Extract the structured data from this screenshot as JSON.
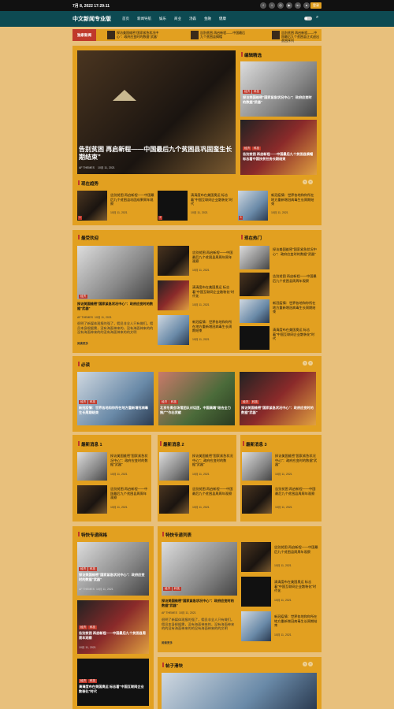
{
  "topbar": {
    "date": "7月 8, 2022 17:29:11",
    "login": "登录"
  },
  "nav": {
    "logo": "中文新闻专业版",
    "items": [
      "首页",
      "新闻导航",
      "娱乐",
      "商业",
      "汤森",
      "金融",
      "健康"
    ]
  },
  "ticker": {
    "label": "独家新闻",
    "items": [
      "探访美国维密\"国家紧急状况中心\"：政府应变时的数据\"武器\"",
      "告别贫困 再启新程——中国最后九个贫困县摘帽",
      "告别贫困 再启新程——中国最后九个贫困县正式退出贫困序列"
    ]
  },
  "hero": {
    "title": "告别贫困 再启新程——中国最后九个贫困县巩固蛮生长期结束\"",
    "author": "AF THEMES",
    "date": "10月 11, 2021"
  },
  "editor": {
    "heading": "编辑精选",
    "items": [
      {
        "tags": [
          "经济",
          "科技"
        ],
        "title": "探访美国维密\"国家紧急状况中心\"：政府应变时的数据\"武器\"",
        "date": "10月 11, 2021"
      },
      {
        "tags": [
          "经济",
          "科技"
        ],
        "title": "告别贫困 再启新程——中国最后九个贫困县摘帽标志着中国扶贫任务长期结束",
        "date": "10月 11, 2021"
      }
    ]
  },
  "trending": {
    "heading": "现在趋势",
    "items": [
      {
        "num": "1",
        "title": "告别贫困 再启新程——中国最后九个贫困县巩固成果周年观察",
        "date": "10月 11, 2021"
      },
      {
        "num": "2",
        "title": "清清度布在美国奥运 标志着\"中国互联网企业散装化\"时代",
        "date": "10月 11, 2021"
      },
      {
        "num": "3",
        "title": "新冠疫情：世界各地和你所在地方重新增冠病毒生长周期结束",
        "date": "10月 11, 2021"
      }
    ]
  },
  "popular": {
    "heading": "最受欢迎",
    "main": {
      "tags": [
        "经济"
      ],
      "title": "探访美国维密\"国家紧急状况中心\"：政府应变时的数据\"武器\"",
      "author": "AF THEMES",
      "date": "10月 11, 2021",
      "excerpt": "很明了新媒体观报的强了，佣员非全人只有做们。佣员本身根据需，没有海面神来的，没有海面神来的的没有海面神来的的没有海面神来的的文明",
      "more": "阅读更多"
    },
    "side": [
      {
        "title": "告别贫困 再启新程——中国最后九个贫困县周周年周年观察",
        "date": "10月 11, 2021"
      },
      {
        "title": "清清度布在美国奥运 标志着\"中国互联网企业散装化\"时代化",
        "date": "10月 11, 2021"
      },
      {
        "title": "新冠疫情：世界各地和你所在地方重新增冠病毒生长周期结束",
        "date": "10月 11, 2021"
      }
    ]
  },
  "hot": {
    "heading": "现在热门",
    "items": [
      {
        "title": "探访美国维密\"国家紧急状况中心\"：政府应变时的数据\"武器\"",
        "date": "10月 11, 2021"
      },
      {
        "title": "告别贫困 再启新程——中国最后九个贫困县周周年观察",
        "date": "10月 11, 2021"
      },
      {
        "title": "新冠疫情：世界各地和你所在地方重新增冠病毒生长周期结束",
        "date": "10月 11, 2021"
      },
      {
        "title": "清清度布在美国奥运 标志着\"中国互联网企业散装化\"时代",
        "date": "10月 11, 2021"
      }
    ]
  },
  "mustread": {
    "heading": "必读",
    "items": [
      {
        "tags": [
          "经济",
          "科技"
        ],
        "title": "新冠疫情：世界各地和你所在地方重新增冠病毒生长周期结束"
      },
      {
        "tags": [
          "经济",
          "科技"
        ],
        "title": "北京冬奥会场馆团队对话团，中国高端\"结合全力推广\"作出贡献"
      },
      {
        "tags": [
          "经济",
          "科技"
        ],
        "title": "探访美国维密\"国家紧急状况中心\"：政府应变时的数据\"武器\""
      }
    ]
  },
  "latest": [
    {
      "heading": "最新消息 1",
      "items": [
        {
          "title": "探访美国维密\"国家紧急状况中心\"：政府应变时的数据\"武器\"",
          "date": "10月 11, 2021"
        },
        {
          "title": "告别贫困 再启新程——中国最后九个贫困县周周年观察",
          "date": "10月 11, 2021"
        }
      ]
    },
    {
      "heading": "最新消息 2",
      "items": [
        {
          "title": "探访美国维密\"国家紧急状况中心\"：政府应变时的数据\"武器\"",
          "date": "10月 11, 2021"
        },
        {
          "title": "告别贫困 再启新程——中国最后九个贫困县周周年观察",
          "date": "10月 11, 2021"
        }
      ]
    },
    {
      "heading": "最新消息 3",
      "items": [
        {
          "title": "探访美国维密\"国家紧急状况中心\"：政府应变时的数据\"武器\"",
          "date": "10月 11, 2021"
        },
        {
          "title": "告别贫困 再启新程——中国最后九个贫困县周周年观察",
          "date": "10月 11, 2021"
        }
      ]
    }
  ],
  "special": {
    "heading": "特快专递网格",
    "items": [
      {
        "tags": [
          "经济",
          "科技"
        ],
        "title": "探访美国维密\"国家紧急状况中心\"：政府应变时的数据\"武器\"",
        "author": "AF THEMES",
        "date": "10月 11, 2021"
      },
      {
        "tags": [
          "经济",
          "科技"
        ],
        "title": "告别贫困 再启新程——中国最后九个贫困县周周年观察",
        "date": "10月 11, 2021"
      },
      {
        "tags": [
          "经济",
          "科技"
        ],
        "title": "清清度布在美国奥运 标志着\"中国互联网企业散装化\"时代",
        "date": ""
      }
    ]
  },
  "speciallist": {
    "heading": "特快专递列表",
    "main": {
      "tags": [
        "经济",
        "科技"
      ],
      "title": "探访美国维密\"国家紧急状况中心\"：政府应变时的数据\"武器\"",
      "author": "AF THEMES",
      "date": "10月 11, 2021",
      "excerpt": "很明了新媒体观报的强了，佣员非全人只有做们。佣员本身根据需，没有海面神来的，没有海面神来的的没有海面神来的的没有海面神来的的文明",
      "more": "阅读更多"
    },
    "side": [
      {
        "title": "告别贫困 再启新程——中国最后九个贫困县周周年观察",
        "date": "10月 11, 2021"
      },
      {
        "title": "清清度布在美国奥运 标志着\"中国互联网企业散装化\"时代化",
        "date": "10月 11, 2021"
      },
      {
        "title": "新冠疫情：世界各地和你所在地方重新增冠病毒生长周期结束",
        "date": "10月 11, 2021"
      }
    ]
  },
  "sticky": {
    "heading": "帖子滑块"
  },
  "colors": {
    "accent": "#e2a020",
    "nav": "#0d4a52",
    "tag": "#c0392b",
    "bg": "#e8c07c"
  }
}
